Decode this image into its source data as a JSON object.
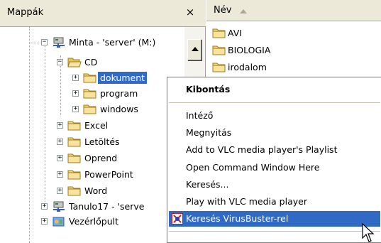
{
  "folders_pane": {
    "title": "Mappák",
    "close_glyph": "×",
    "tree": [
      {
        "label": "Minta - 'server' (M:)",
        "icon": "network-drive-icon",
        "expander": "−"
      },
      {
        "label": "CD",
        "icon": "folder-open-icon",
        "expander": "−"
      },
      {
        "label": "dokument",
        "icon": "folder-icon",
        "expander": "+",
        "selected": true
      },
      {
        "label": "program",
        "icon": "folder-icon",
        "expander": "+"
      },
      {
        "label": "windows",
        "icon": "folder-icon",
        "expander": "+"
      },
      {
        "label": "Excel",
        "icon": "folder-icon",
        "expander": "+"
      },
      {
        "label": "Letöltés",
        "icon": "folder-icon",
        "expander": "+"
      },
      {
        "label": "Oprend",
        "icon": "folder-icon",
        "expander": "+"
      },
      {
        "label": "PowerPoint",
        "icon": "folder-icon",
        "expander": "+"
      },
      {
        "label": "Word",
        "icon": "folder-icon",
        "expander": "+"
      },
      {
        "label": "Tanulo17 - 'serve",
        "icon": "network-drive-icon",
        "expander": "+"
      },
      {
        "label": "Vezérlőpult",
        "icon": "control-panel-icon",
        "expander": "+"
      }
    ]
  },
  "file_list": {
    "column_name": "Név",
    "sort_direction": "ascending",
    "items": [
      {
        "label": "AVI"
      },
      {
        "label": "BIOLOGIA"
      },
      {
        "label": "irodalom"
      }
    ]
  },
  "context_menu": {
    "items": [
      {
        "label": "Kibontás",
        "bold": true
      },
      {
        "label": "Intéző"
      },
      {
        "label": "Megnyitás"
      },
      {
        "label": "Add to VLC media player's Playlist"
      },
      {
        "label": "Open Command Window Here"
      },
      {
        "label": "Keresés..."
      },
      {
        "label": "Play with VLC media player"
      },
      {
        "label": "Keresés VirusBuster-rel",
        "highlighted": true,
        "icon": "virusbuster-icon"
      }
    ]
  },
  "colors": {
    "selection": "#316ac5",
    "folder": "#f5d77d",
    "header_bg": "#ece9d8"
  }
}
